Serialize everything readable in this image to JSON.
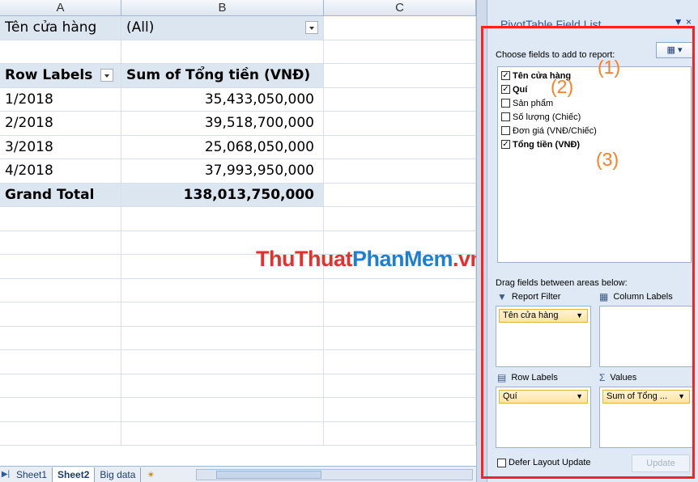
{
  "columns": [
    "A",
    "B",
    "C"
  ],
  "filter": {
    "label": "Tên cửa hàng",
    "value": "(All)"
  },
  "table_headers": {
    "row_labels": "Row Labels",
    "sum": "Sum of Tổng tiền (VNĐ)"
  },
  "rows": [
    {
      "label": "1/2018",
      "value": "35,433,050,000"
    },
    {
      "label": "2/2018",
      "value": "39,518,700,000"
    },
    {
      "label": "3/2018",
      "value": "25,068,050,000"
    },
    {
      "label": "4/2018",
      "value": "37,993,950,000"
    }
  ],
  "grand_total": {
    "label": "Grand Total",
    "value": "138,013,750,000"
  },
  "watermark": {
    "part1": "ThuThuat",
    "part2": "PhanMem",
    "part3": ".vn"
  },
  "sheet_tabs": [
    "Sheet1",
    "Sheet2",
    "Big data"
  ],
  "active_tab": "Sheet2",
  "pivot": {
    "title": "PivotTable Field List",
    "choose_label": "Choose fields to add to report:",
    "fields": [
      {
        "label": "Tên cửa hàng",
        "checked": true
      },
      {
        "label": "Quí",
        "checked": true
      },
      {
        "label": "Sản phẩm",
        "checked": false
      },
      {
        "label": "Số lượng (Chiếc)",
        "checked": false
      },
      {
        "label": "Đơn giá (VNĐ/Chiếc)",
        "checked": false
      },
      {
        "label": "Tổng tiền (VNĐ)",
        "checked": true
      }
    ],
    "annotations": [
      "(1)",
      "(2)",
      "(3)"
    ],
    "drag_label": "Drag fields between areas below:",
    "areas": {
      "report_filter": {
        "title": "Report Filter",
        "item": "Tên cửa hàng"
      },
      "column_labels": {
        "title": "Column Labels",
        "item": ""
      },
      "row_labels": {
        "title": "Row Labels",
        "item": "Quí"
      },
      "values": {
        "title": "Values",
        "item": "Sum of Tổng ..."
      }
    },
    "defer_label": "Defer Layout Update",
    "update_label": "Update"
  },
  "colors": {
    "annotation": "#ff7e22",
    "highlight_frame": "#ff2020",
    "header_band": "#dce6f1"
  }
}
